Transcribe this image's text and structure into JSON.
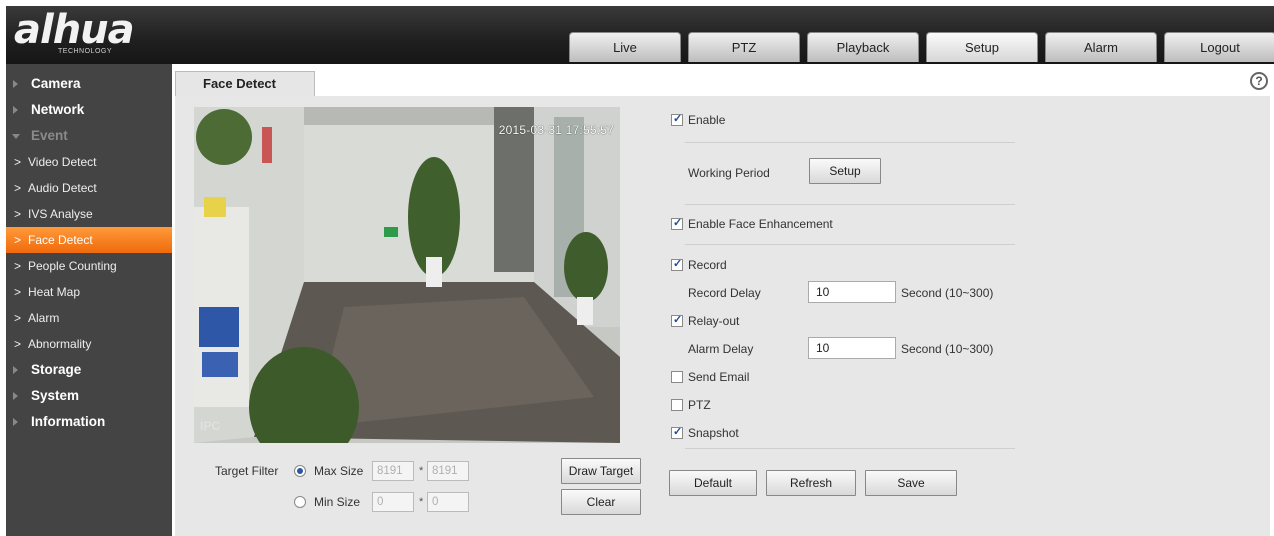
{
  "brand": {
    "logo": "alhua",
    "sub": "TECHNOLOGY"
  },
  "tabs": [
    "Live",
    "PTZ",
    "Playback",
    "Setup",
    "Alarm",
    "Logout"
  ],
  "active_tab": "Setup",
  "sidebar": {
    "camera": "Camera",
    "network": "Network",
    "event": "Event",
    "event_items": [
      "Video Detect",
      "Audio Detect",
      "IVS Analyse",
      "Face Detect",
      "People Counting",
      "Heat Map",
      "Alarm",
      "Abnormality"
    ],
    "active_event_item": "Face Detect",
    "storage": "Storage",
    "system": "System",
    "information": "Information"
  },
  "page": {
    "title": "Face Detect",
    "help": "?"
  },
  "video": {
    "timestamp": "2015-03-31 17:55:57",
    "watermark": "IPC"
  },
  "target_filter": {
    "label": "Target Filter",
    "max_label": "Max Size",
    "max_w": "8191",
    "max_h": "8191",
    "min_label": "Min Size",
    "min_w": "0",
    "min_h": "0",
    "star": "*",
    "selected": "max"
  },
  "buttons": {
    "draw_target": "Draw Target",
    "clear": "Clear",
    "setup": "Setup",
    "default": "Default",
    "refresh": "Refresh",
    "save": "Save"
  },
  "settings": {
    "enable": "Enable",
    "working_period": "Working Period",
    "face_enhancement": "Enable Face Enhancement",
    "record": "Record",
    "record_delay_label": "Record Delay",
    "record_delay": "10",
    "record_delay_range": "Second (10~300)",
    "relay_out": "Relay-out",
    "alarm_delay_label": "Alarm Delay",
    "alarm_delay": "10",
    "alarm_delay_range": "Second (10~300)",
    "send_email": "Send Email",
    "ptz": "PTZ",
    "snapshot": "Snapshot"
  },
  "checked": {
    "enable": true,
    "face_enhancement": true,
    "record": true,
    "relay_out": true,
    "send_email": false,
    "ptz": false,
    "snapshot": true
  }
}
